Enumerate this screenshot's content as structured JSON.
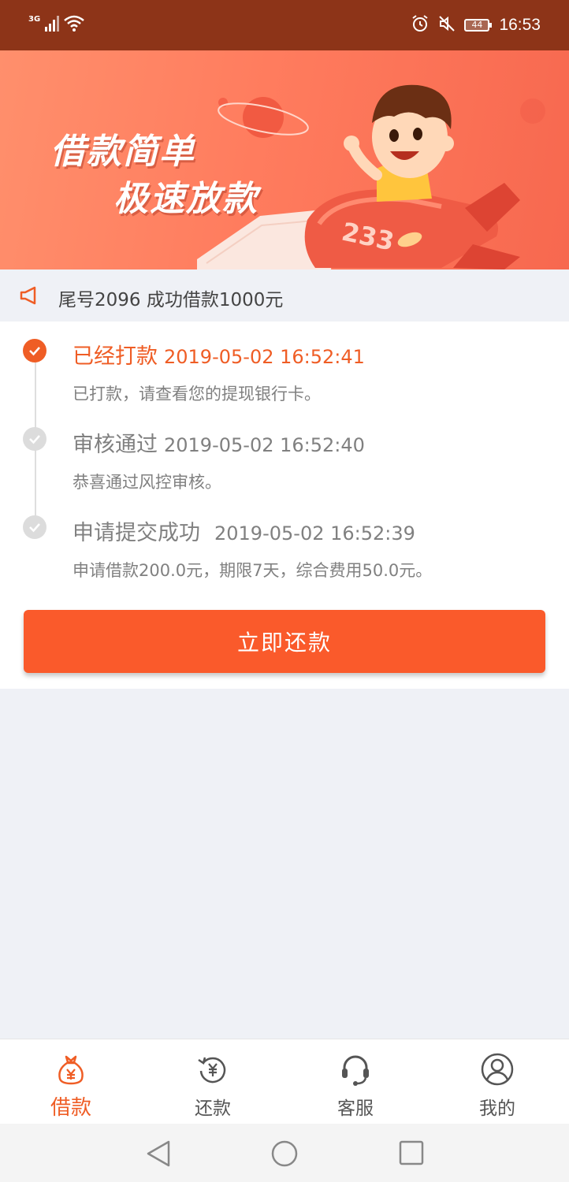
{
  "status_bar": {
    "network_type": "3G",
    "battery_level": "44",
    "time": "16:53",
    "icons": [
      "signal-icon",
      "wifi-icon",
      "alarm-icon",
      "mute-icon",
      "battery-icon"
    ]
  },
  "banner": {
    "line1": "借款简单",
    "line2": "极速放款",
    "rocket_number": "233"
  },
  "notice": {
    "icon": "speaker-icon",
    "text": "尾号2096 成功借款1000元"
  },
  "timeline": {
    "steps": [
      {
        "title": "已经打款",
        "time": "2019-05-02 16:52:41",
        "description": "已打款，请查看您的提现银行卡。",
        "status": "active"
      },
      {
        "title": "审核通过",
        "time": "2019-05-02 16:52:40",
        "description": "恭喜通过风控审核。",
        "status": "done"
      },
      {
        "title": "申请提交成功",
        "time": "2019-05-02 16:52:39",
        "description": "申请借款200.0元，期限7天，综合费用50.0元。",
        "status": "done"
      }
    ]
  },
  "actions": {
    "repay_label": "立即还款"
  },
  "bottom_nav": {
    "items": [
      {
        "label": "借款",
        "icon": "money-bag-icon",
        "selected": true
      },
      {
        "label": "还款",
        "icon": "yuan-refresh-icon",
        "selected": false
      },
      {
        "label": "客服",
        "icon": "headset-icon",
        "selected": false
      },
      {
        "label": "我的",
        "icon": "user-icon",
        "selected": false
      }
    ]
  },
  "colors": {
    "accent": "#ef5d25",
    "button": "#fa5a2b",
    "status_bar": "#8d3418",
    "background": "#eff1f6"
  }
}
